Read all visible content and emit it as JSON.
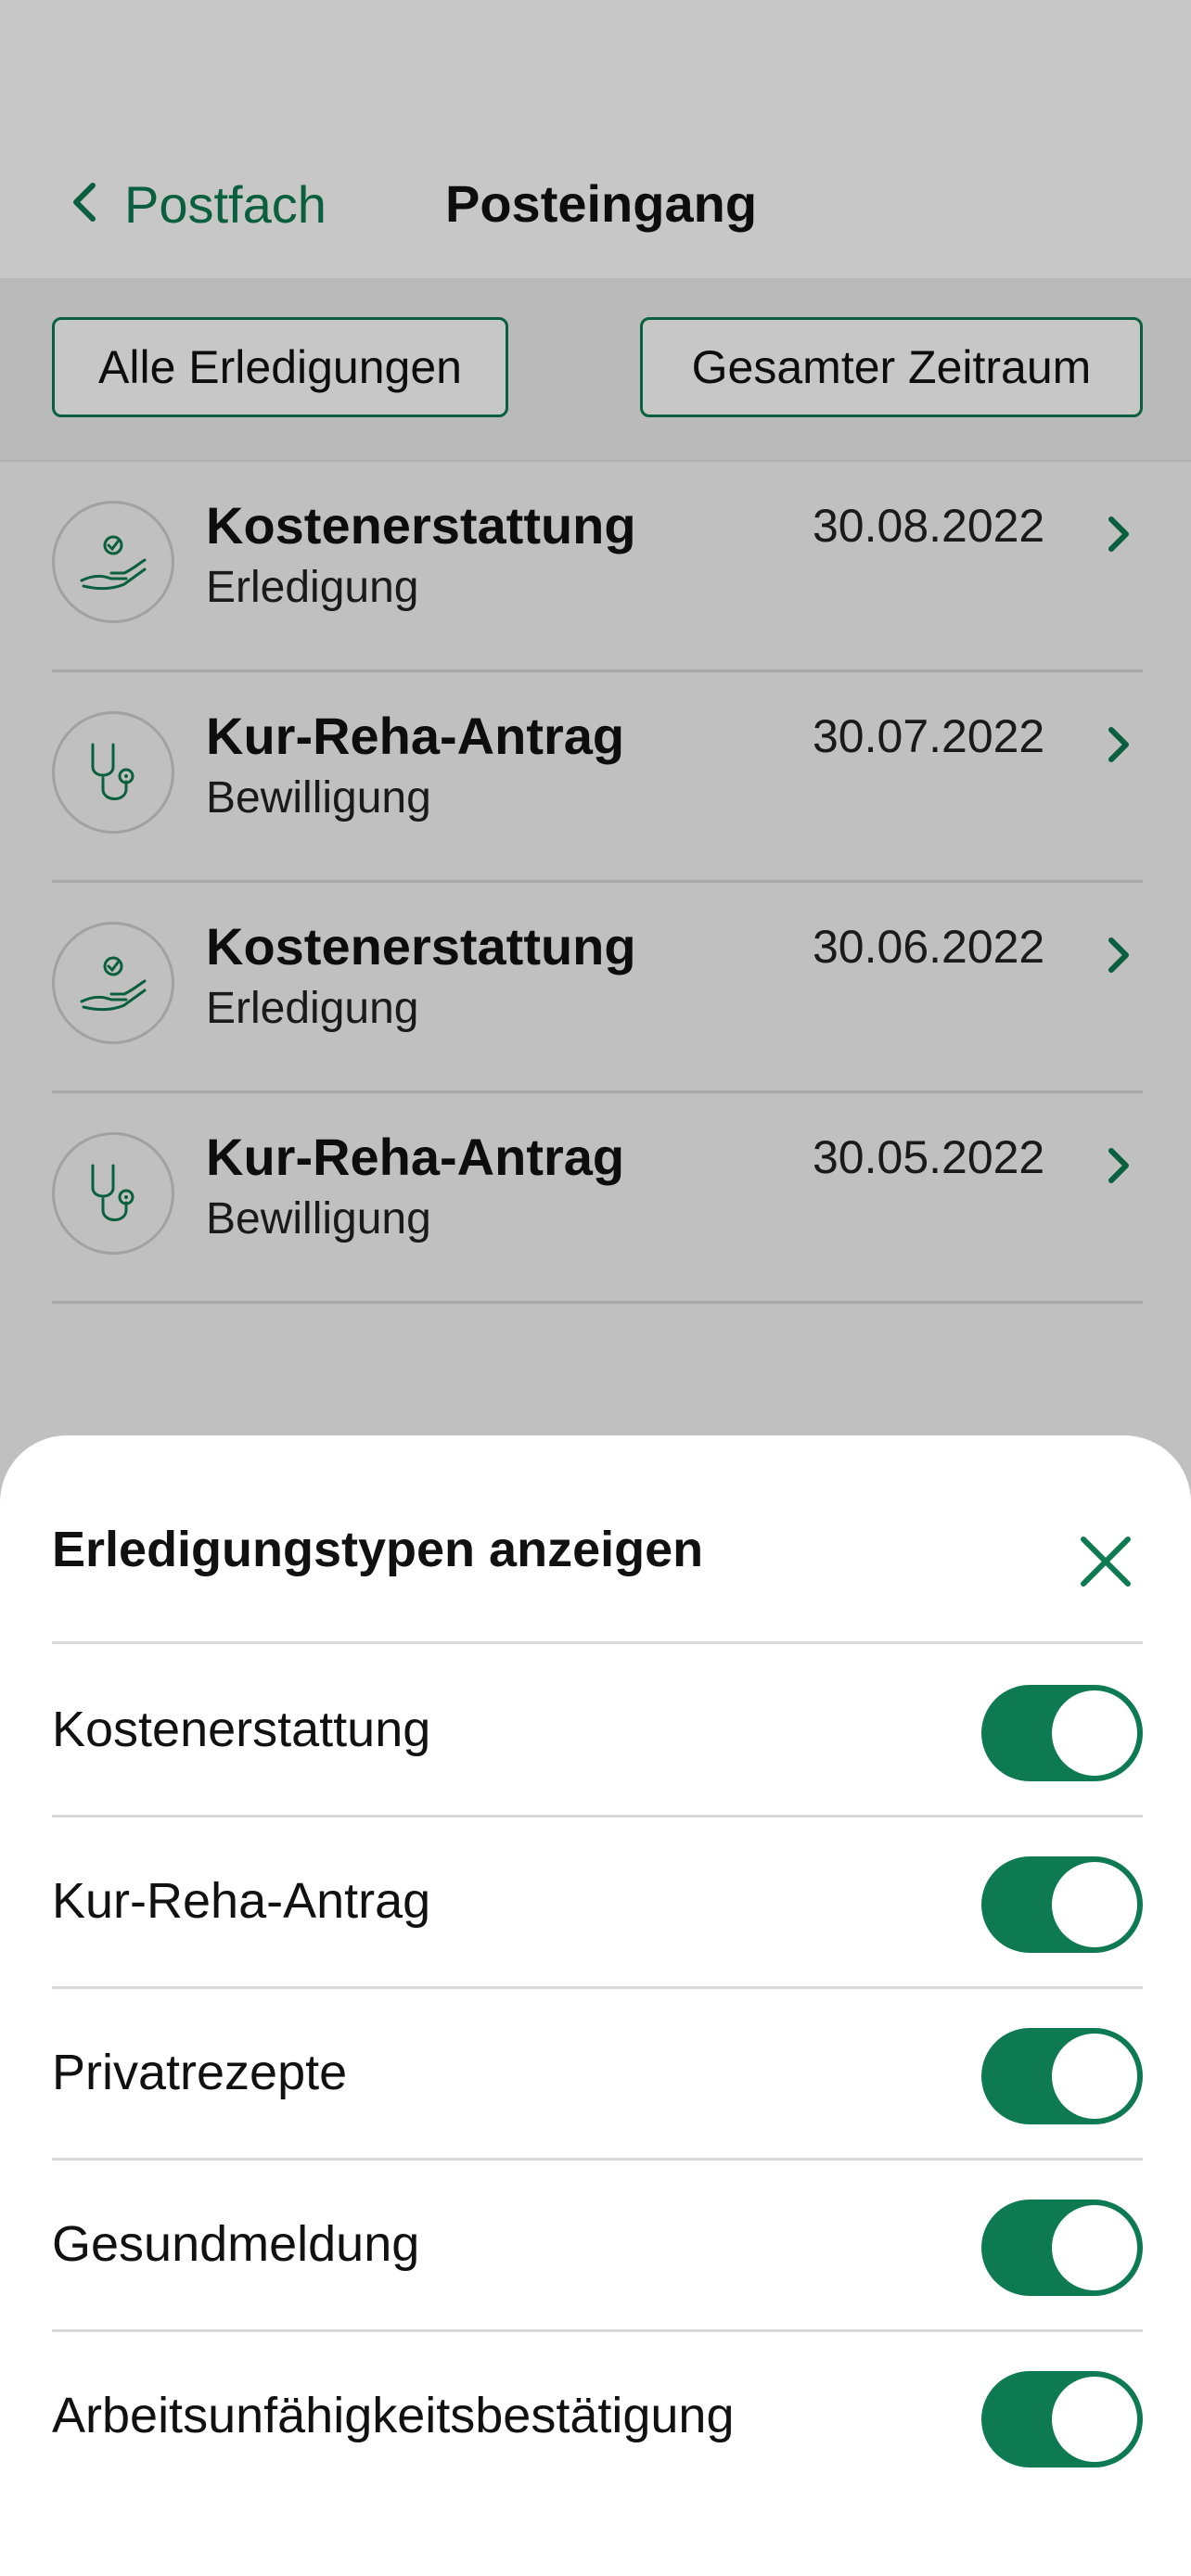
{
  "colors": {
    "accent": "#0e7a52",
    "divider": "#d8d8d8"
  },
  "header": {
    "back_label": "Postfach",
    "title": "Posteingang"
  },
  "filters": {
    "type_label": "Alle Erledigungen",
    "period_label": "Gesamter Zeitraum"
  },
  "messages": [
    {
      "title": "Kostenerstattung",
      "subtitle": "Erledigung",
      "date": "30.08.2022",
      "icon": "hand-check-icon"
    },
    {
      "title": "Kur-Reha-Antrag",
      "subtitle": "Bewilligung",
      "date": "30.07.2022",
      "icon": "stethoscope-icon"
    },
    {
      "title": "Kostenerstattung",
      "subtitle": "Erledigung",
      "date": "30.06.2022",
      "icon": "hand-check-icon"
    },
    {
      "title": "Kur-Reha-Antrag",
      "subtitle": "Bewilligung",
      "date": "30.05.2022",
      "icon": "stethoscope-icon"
    }
  ],
  "sheet": {
    "title": "Erledigungstypen anzeigen",
    "options": [
      {
        "label": "Kostenerstattung",
        "enabled": true
      },
      {
        "label": "Kur-Reha-Antrag",
        "enabled": true
      },
      {
        "label": "Privatrezepte",
        "enabled": true
      },
      {
        "label": "Gesundmeldung",
        "enabled": true
      },
      {
        "label": "Arbeitsunfähigkeitsbestätigung",
        "enabled": true
      }
    ]
  }
}
